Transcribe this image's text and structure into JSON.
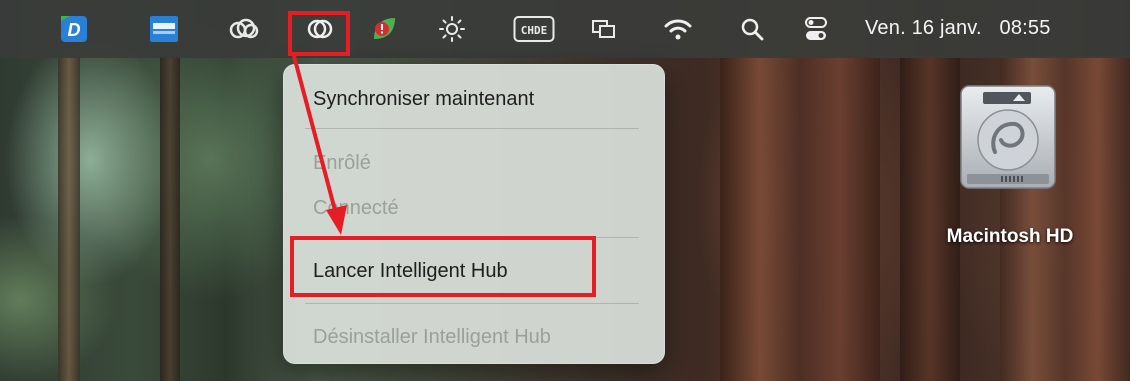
{
  "menubar": {
    "icons": [
      {
        "name": "dymo-d-icon",
        "glyph": "D"
      },
      {
        "name": "dymo-connect-icon",
        "glyph": "DYMO"
      },
      {
        "name": "creative-cloud-icon",
        "glyph": "cc"
      },
      {
        "name": "intelligent-hub-icon",
        "glyph": "hub"
      },
      {
        "name": "alert-leaf-icon",
        "glyph": "!"
      },
      {
        "name": "brightness-icon",
        "glyph": "☀"
      },
      {
        "name": "input-source-icon",
        "glyph": "CHDE"
      },
      {
        "name": "display-mirror-icon",
        "glyph": "⧉"
      },
      {
        "name": "wifi-icon",
        "glyph": "wifi"
      },
      {
        "name": "spotlight-search-icon",
        "glyph": "🔍"
      },
      {
        "name": "control-center-icon",
        "glyph": "cc"
      }
    ],
    "date": "Ven. 16 janv.",
    "time": "08:55"
  },
  "menu": {
    "items": [
      {
        "label": "Synchroniser maintenant",
        "enabled": true
      },
      {
        "label": "Enrôlé",
        "enabled": false
      },
      {
        "label": "Connecté",
        "enabled": false
      },
      {
        "label": "Lancer Intelligent Hub",
        "enabled": true
      },
      {
        "label": "Désinstaller Intelligent Hub",
        "enabled": false
      }
    ]
  },
  "desktop": {
    "disk_label": "Macintosh HD"
  },
  "annotation_color": "#e51e25"
}
